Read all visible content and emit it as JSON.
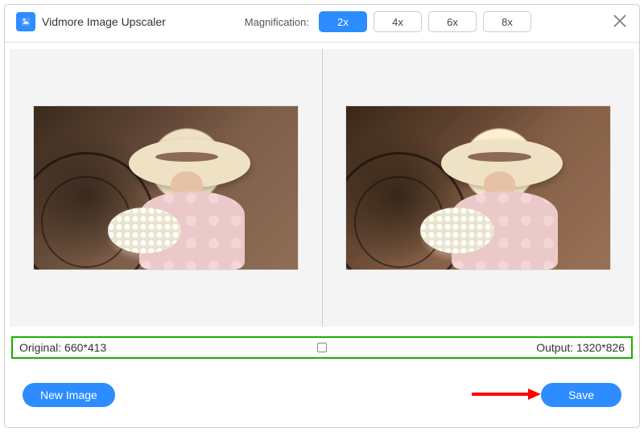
{
  "app": {
    "title": "Vidmore Image Upscaler"
  },
  "header": {
    "magnification_label": "Magnification:",
    "options": [
      "2x",
      "4x",
      "6x",
      "8x"
    ],
    "selected": "2x"
  },
  "dimensions": {
    "original_label": "Original:",
    "original_value": "660*413",
    "output_label": "Output:",
    "output_value": "1320*826"
  },
  "footer": {
    "new_image_label": "New Image",
    "save_label": "Save"
  },
  "colors": {
    "accent": "#2d8cff",
    "highlight_border": "#1cad00",
    "arrow": "#ff0000"
  }
}
